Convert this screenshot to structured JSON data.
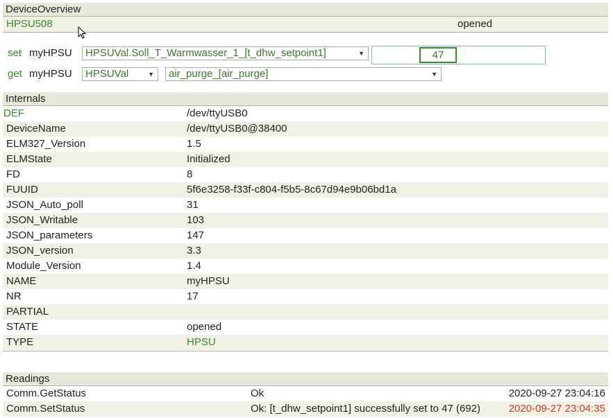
{
  "device_overview": {
    "header": "DeviceOverview",
    "device_name": "HPSU508",
    "state": "opened"
  },
  "set_row": {
    "cmd_label": "set",
    "device": "myHPSU",
    "reading_select": "HPSUVal.Soll_T_Warmwasser_1_[t_dhw_setpoint1]",
    "value": "47"
  },
  "get_row": {
    "cmd_label": "get",
    "device": "myHPSU",
    "type_select": "HPSUVal",
    "reading_select": "air_purge_[air_purge]"
  },
  "internals": {
    "header": "Internals",
    "rows": [
      {
        "key": "DEF",
        "value": "/dev/ttyUSB0"
      },
      {
        "key": "DeviceName",
        "value": "/dev/ttyUSB0@38400"
      },
      {
        "key": "ELM327_Version",
        "value": "1.5"
      },
      {
        "key": "ELMState",
        "value": "Initialized"
      },
      {
        "key": "FD",
        "value": "8"
      },
      {
        "key": "FUUID",
        "value": "5f6e3258-f33f-c804-f5b5-8c67d94e9b06bd1a"
      },
      {
        "key": "JSON_Auto_poll",
        "value": "31"
      },
      {
        "key": "JSON_Writable",
        "value": "103"
      },
      {
        "key": "JSON_parameters",
        "value": "147"
      },
      {
        "key": "JSON_version",
        "value": "3.3"
      },
      {
        "key": "Module_Version",
        "value": "1.4"
      },
      {
        "key": "NAME",
        "value": "myHPSU"
      },
      {
        "key": "NR",
        "value": "17"
      },
      {
        "key": "PARTIAL",
        "value": ""
      },
      {
        "key": "STATE",
        "value": "opened"
      },
      {
        "key": "TYPE",
        "value": "HPSU"
      }
    ]
  },
  "readings": {
    "header": "Readings",
    "rows": [
      {
        "name": "Comm.GetStatus",
        "value": "Ok",
        "time": "2020-09-27 23:04:16"
      },
      {
        "name": "Comm.SetStatus",
        "value": "Ok: [t_dhw_setpoint1] successfully set to 47 (692)",
        "time": "2020-09-27 23:04:35"
      }
    ]
  },
  "colors": {
    "link_green": "#3a8a2a",
    "recent_red": "#d03a2a",
    "header_bg": "#e8e8da",
    "alt_row_bg": "#f0f0e4"
  }
}
